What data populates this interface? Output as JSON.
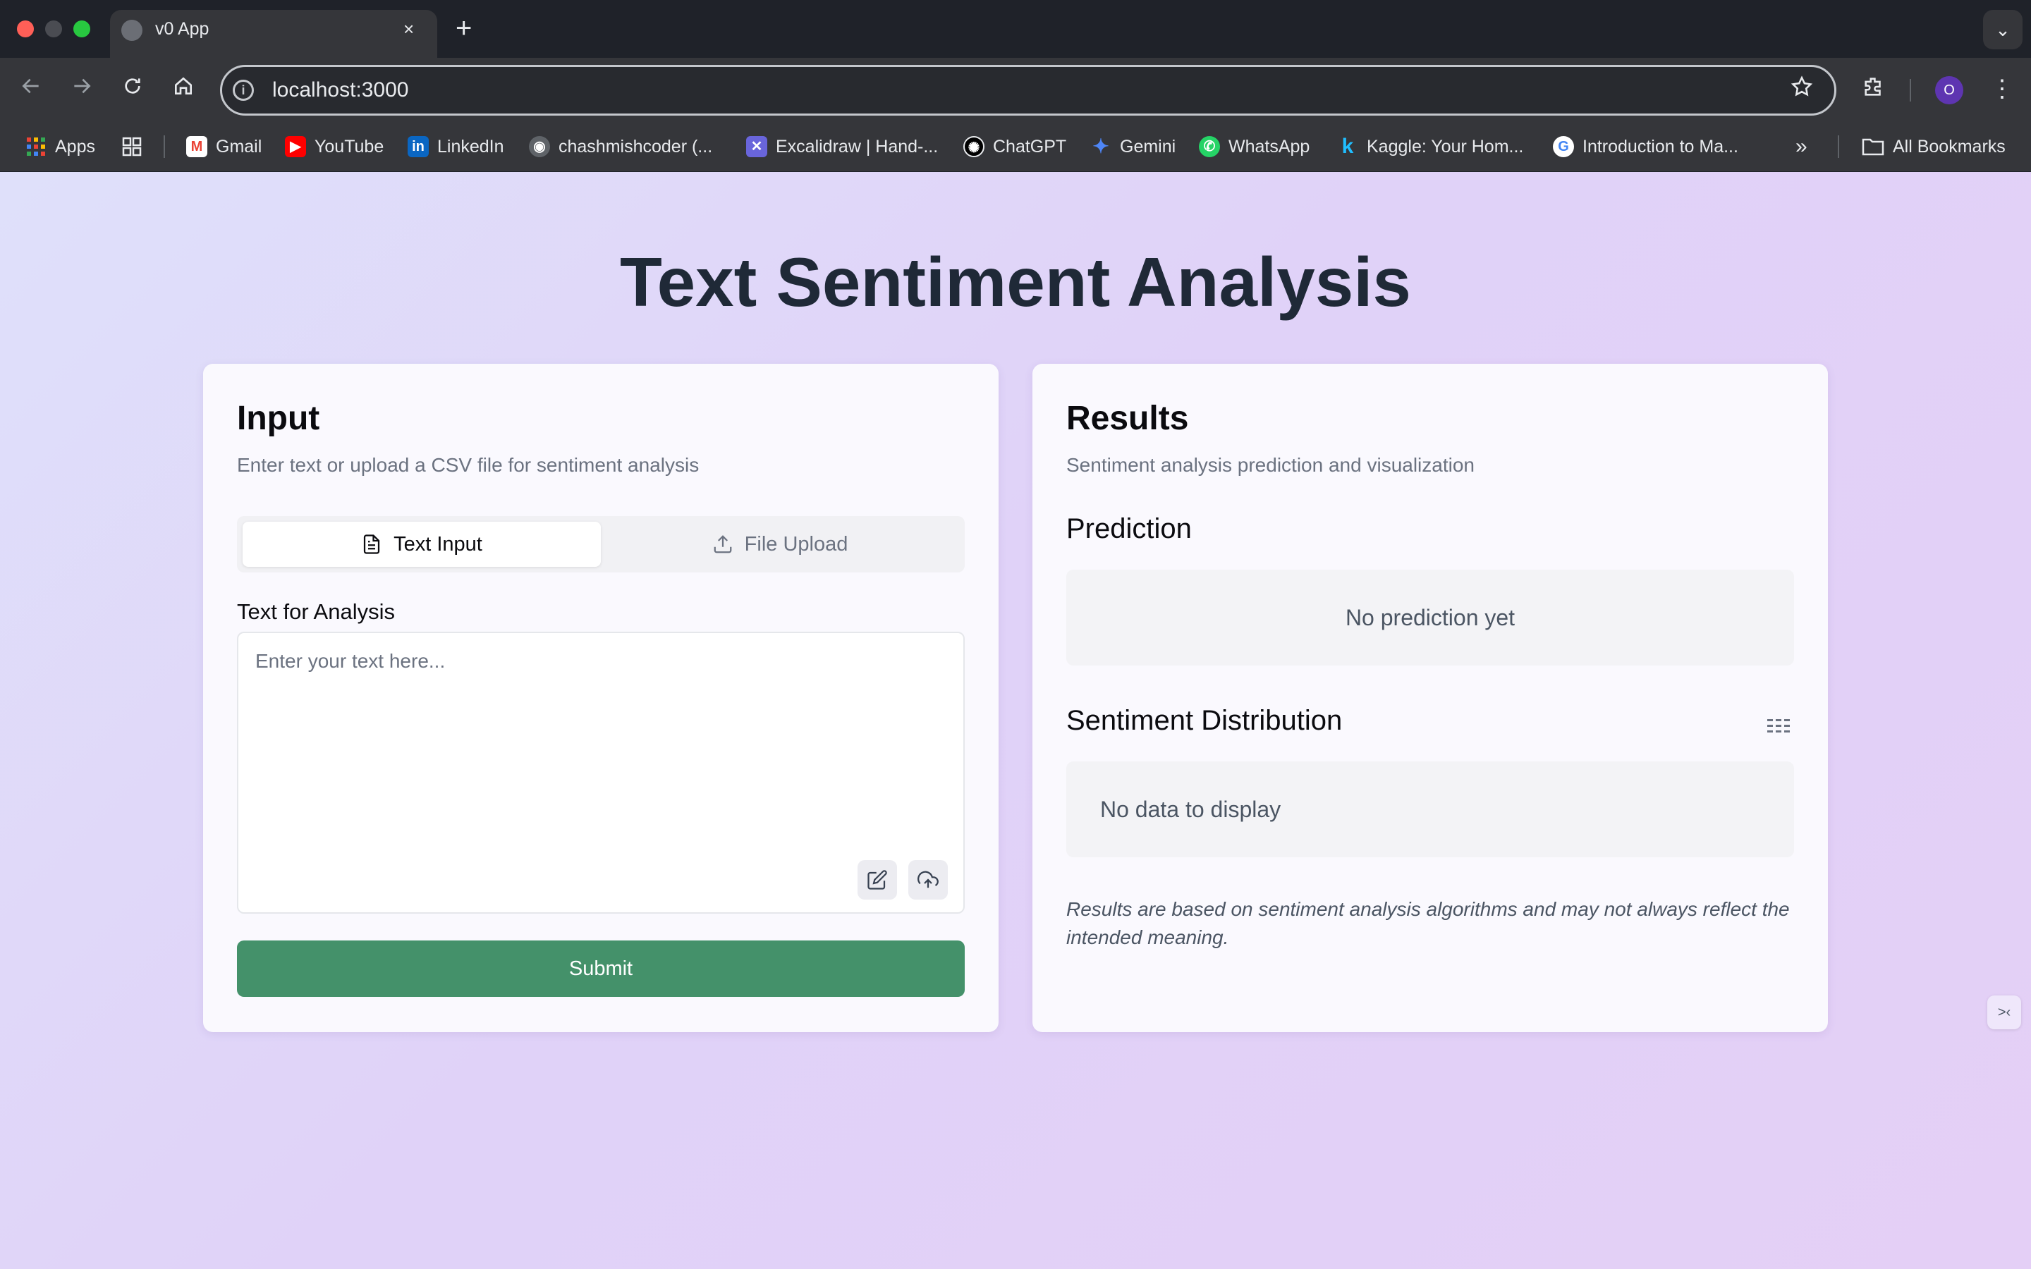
{
  "browser": {
    "tab_title": "v0 App",
    "tab_close": "×",
    "new_tab": "+",
    "tab_search": "⌄",
    "url": "localhost:3000",
    "profile_initial": "O",
    "icons": [
      "back-icon",
      "forward-icon",
      "reload-icon",
      "home-icon",
      "site-info-icon",
      "star-icon",
      "extensions-icon",
      "menu-icon"
    ]
  },
  "bookmarks": {
    "items": [
      {
        "label": "Apps",
        "color": "#ea4335"
      },
      {
        "label": "Gmail",
        "color": "#ea4335"
      },
      {
        "label": "YouTube",
        "color": "#ff0000"
      },
      {
        "label": "LinkedIn",
        "color": "#0a66c2"
      },
      {
        "label": "chashmishcoder (...",
        "color": "#24292f"
      },
      {
        "label": "Excalidraw | Hand-...",
        "color": "#6965db"
      },
      {
        "label": "ChatGPT",
        "color": "#000000"
      },
      {
        "label": "Gemini",
        "color": "#4e86f7"
      },
      {
        "label": "WhatsApp",
        "color": "#25d366"
      },
      {
        "label": "Kaggle: Your Hom...",
        "color": "#20beff"
      },
      {
        "label": "Introduction to Ma...",
        "color": "#ffffff"
      }
    ],
    "overflow": "»",
    "all_bookmarks": "All Bookmarks"
  },
  "page": {
    "title": "Text Sentiment Analysis"
  },
  "input_card": {
    "title": "Input",
    "subtitle": "Enter text or upload a CSV file for sentiment analysis",
    "tabs": [
      {
        "label": "Text Input",
        "icon": "document-icon",
        "active": true
      },
      {
        "label": "File Upload",
        "icon": "upload-icon",
        "active": false
      }
    ],
    "field_label": "Text for Analysis",
    "placeholder": "Enter your text here...",
    "submit_label": "Submit"
  },
  "results_card": {
    "title": "Results",
    "subtitle": "Sentiment analysis prediction and visualization",
    "prediction_title": "Prediction",
    "prediction_empty": "No prediction yet",
    "distribution_title": "Sentiment Distribution",
    "distribution_empty": "No data to display",
    "disclaimer": "Results are based on sentiment analysis algorithms and may not always reflect the intended meaning."
  },
  "colors": {
    "accent": "#44916a",
    "background_from": "#dfe0fa",
    "background_to": "#e4cff6"
  }
}
